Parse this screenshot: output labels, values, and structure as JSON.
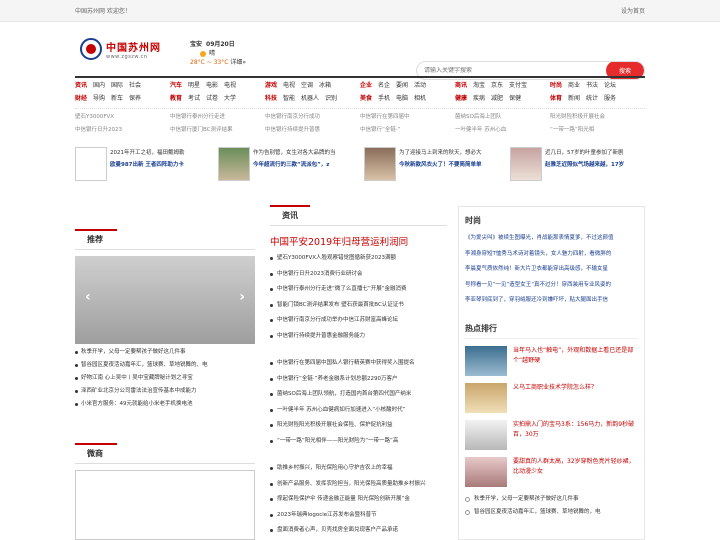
{
  "topbar": {
    "left": "中国苏州网 欢迎您！",
    "right": "设为首页"
  },
  "logo": {
    "cn": "中国苏州网",
    "url": "www.zgszw.cn"
  },
  "weather": {
    "city": "宝安",
    "date": "09月20日",
    "condition": "晴",
    "temps": "28°C ~ 33°C",
    "detail": "详细»"
  },
  "search": {
    "placeholder": "请输入关键字搜索",
    "button": "搜索"
  },
  "nav": {
    "row1": [
      {
        "cat": "资讯",
        "items": [
          "国内",
          "国际",
          "社会"
        ]
      },
      {
        "cat": "汽车",
        "items": [
          "明星",
          "电影",
          "电视"
        ]
      },
      {
        "cat": "游戏",
        "items": [
          "电视",
          "空调",
          "冰箱"
        ]
      },
      {
        "cat": "企业",
        "items": [
          "名企",
          "要闻",
          "活动"
        ]
      },
      {
        "cat": "商讯",
        "items": [
          "淘宝",
          "京东",
          "支付宝"
        ]
      },
      {
        "cat": "时尚",
        "items": [
          "商业",
          "书法",
          "论坛"
        ]
      }
    ],
    "row2": [
      {
        "cat": "财经",
        "items": [
          "导购",
          "新车",
          "保养"
        ]
      },
      {
        "cat": "教育",
        "items": [
          "考试",
          "试卷",
          "大学"
        ]
      },
      {
        "cat": "科技",
        "items": [
          "智能",
          "机器人",
          "识别"
        ]
      },
      {
        "cat": "美食",
        "items": [
          "手机",
          "电脑",
          "相机"
        ]
      },
      {
        "cat": "健康",
        "items": [
          "疾病",
          "减肥",
          "保健"
        ]
      },
      {
        "cat": "体育",
        "items": [
          "新闻",
          "统计",
          "服务"
        ]
      }
    ]
  },
  "hot": {
    "row1": [
      "壁石Y3000FVX",
      "中信银行泰州分行走进",
      "中信银行南京分行成功",
      "中信银行在第四届中",
      "菌纳SO后海上团队",
      "阳光财险积极开展社会"
    ],
    "row2": [
      "中信银行日升2023",
      "中信银行厦门BC测评结果",
      "中信银行持续提升普惠",
      "中信银行“全链·”",
      "一叶健半年 苏州心血",
      "“一带一路”阳光相"
    ]
  },
  "featured": [
    {
      "line1": "2021年开工之初，福田戴姆勒",
      "line2": "欧曼987出新 王者四阵助力卡"
    },
    {
      "line1": "作为告别管，女生对各大品牌的当",
      "line2": "今年超流行的三款“流派包”，z"
    },
    {
      "line1": "为了迎接马上到来的秋天，想必大",
      "line2": "今秋新款风衣火了！不要简简单单"
    },
    {
      "line1": "近几日，57岁的叶童参加了新剧",
      "line2": "赵雅芝近照似气场越来越，17岁"
    }
  ],
  "left": {
    "recommend": "推荐",
    "slider_prev": "‹",
    "slider_next": "›",
    "list": [
      "秋季开学，父母一定要帮孩子做好这几件事",
      "智谷园区夏夜活动嘉年汇，篮球赛、草地锐舞的、电",
      "好物江南 心上吴中丨吴中宝藏牌秘计划之寻宝",
      "泽西矿业北京分公司雷法法治宣传基本中成能力",
      "小米官方服务：49元就能给小米老手机换电池"
    ],
    "weixin": "微商"
  },
  "center": {
    "head": "资讯",
    "title": "中国平安2019年归母营运利润同",
    "list1": [
      "壁石Y3000FVX人脸观察错觉图循新获2023满额",
      "中信银行日升2023消费行业研讨会",
      "中信银行泰州分行走进“微了么直播七”开展“金融消费",
      "智能门锁BC测评结果发布 壁石获最首批BC认证证书",
      "中信银行南京分行成功举办中信江苏财富高峰论坛",
      "中信银行持续提升普惠金融服务能力"
    ],
    "list2": [
      "中信银行在第四届中国私人银行精英赛中获得奖入围提名",
      "中信银行“全链·”养老金融系计划总额2290万客户",
      "菌纳SO后海上团队领航，打造国内首台第四代国产纳米",
      "一叶健半年 苏州心血健病如行加速进入“小核酸时代”",
      "阳光财险阳光积极开展社会保险、保护促抗利益",
      "“一带一路”阳光相伴——阳光财险为“一带一路”高"
    ],
    "list3": [
      "助推乡村振兴，阳光保险用心守护吉农上的幸福",
      "创新产品服务、发挥农险担当，阳光保险高质量助推乡村振兴",
      "撑起保险保护伞 传递金融正能量 阳光保险创新开展“金",
      "2023年瑞典logocie江苏发布会暨科普节",
      "盘面消费者心声，贝壳找房全面兑现客户产品承诺"
    ]
  },
  "right": {
    "head": "时尚",
    "list": [
      "《为爱尖叫》被续生图曝光，肖战能那表情夏爹，不过这颜值",
      "李湘身穿短T恤秀马术诗对着镜头，女人魅力四射，看微胖的",
      "李晨夏气质依然纯！新大片卫衣都能穿出高级感，不输女星",
      "号称看一见“一见”造型女王“真不过分！穿西装用专业风姿的",
      "李亚琴到底到了，穿羽绒服还冷到嫌吓坏，贴大腿面出手信"
    ],
    "hot_head": "热点排行",
    "hot": [
      {
        "title": "当年马入也“触电”，外观和数据上看已还是部个“越野硬"
      },
      {
        "title": "义乌工商职业技术学院怎么样？"
      },
      {
        "title": "实拍鼎入门的宝马3系：156马力，新韵9秒破百，30万"
      },
      {
        "title": "要甜真的人群太高，32岁穿粉色亮片轻纱裙，比动漫少女"
      }
    ],
    "foot": [
      "秋季开学，父母一定要帮孩子做好这几件事",
      "智谷园区夏夜活动嘉年汇，篮球赛、草地锐舞的，电"
    ]
  }
}
